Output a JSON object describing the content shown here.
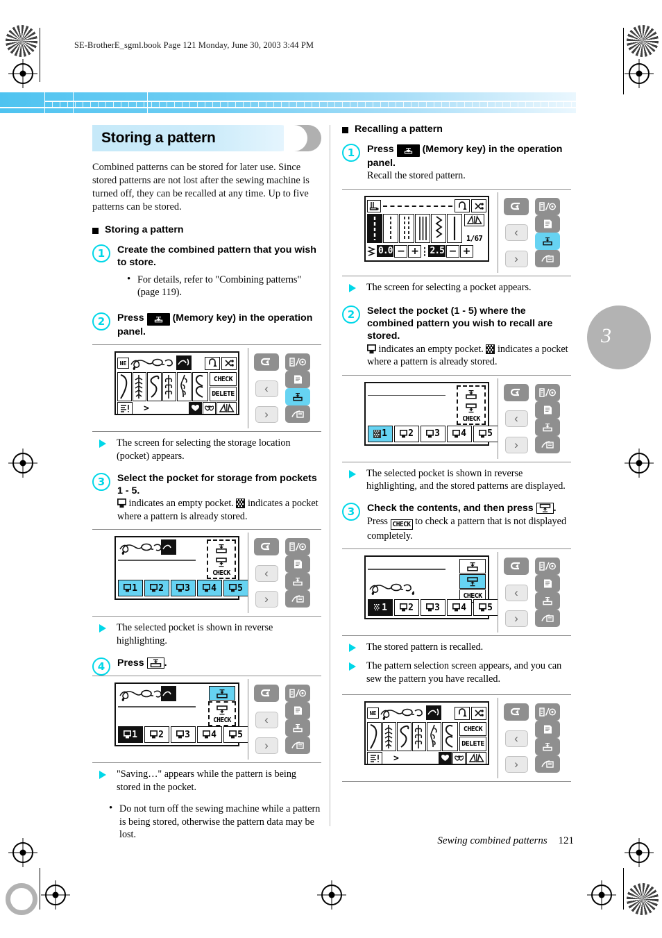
{
  "page": {
    "running_header": "SE-BrotherE_sgml.book  Page 121  Monday, June 30, 2003  3:44 PM",
    "chapter_tab": "3",
    "footer_title": "Sewing combined patterns",
    "footer_page": "121",
    "accent_cyan": "#00d7e8",
    "lcd_select_cyan": "#66d3f2",
    "band_blue": "#4ec3f0"
  },
  "left_column": {
    "section_title": "Storing a pattern",
    "intro": "Combined patterns can be stored for later use. Since stored patterns are not lost after the sewing machine is turned off, they can be recalled at any time. Up to five patterns can be stored.",
    "subhead": "Storing a pattern",
    "step1": {
      "num": "1",
      "head": "Create the combined pattern that you wish to store.",
      "bullet": "For details, refer to \"Combining patterns\" (page 119)."
    },
    "step2": {
      "num": "2",
      "head_pre": "Press",
      "head_post": "(Memory key) in the operation panel.",
      "result": "The screen for selecting the storage location (pocket) appears."
    },
    "step3": {
      "num": "3",
      "head": "Select the pocket for storage from pockets 1 - 5.",
      "sub_a": "indicates an empty pocket.",
      "sub_b": "indicates a pocket where a pattern is already stored.",
      "result": "The selected pocket is shown in reverse highlighting."
    },
    "step4": {
      "num": "4",
      "head_pre": "Press",
      "head_post": ".",
      "result": "\"Saving…\" appears while the pattern is being stored in the pocket.",
      "bullet": "Do not turn off the sewing machine while a pattern is being stored, otherwise the pattern data may be lost."
    }
  },
  "right_column": {
    "subhead": "Recalling a pattern",
    "step1": {
      "num": "1",
      "head_pre": "Press",
      "head_post": "(Memory key) in the operation panel.",
      "sub": "Recall the stored pattern.",
      "result": "The screen for selecting a pocket appears."
    },
    "step2": {
      "num": "2",
      "head": "Select the pocket (1 - 5) where the combined pattern you wish to recall are stored.",
      "sub_a": "indicates an empty pocket.",
      "sub_b": "indicates a pocket where a pattern is already stored.",
      "result": "The selected pocket is shown in reverse highlighting, and the stored patterns are displayed."
    },
    "step3": {
      "num": "3",
      "head_pre": "Check the contents, and then press",
      "head_post": ".",
      "sub_pre": "Press",
      "sub_post": "to check a pattern that is not displayed completely.",
      "result_a": "The stored pattern is recalled.",
      "result_b": "The pattern selection screen appears, and you can sew the pattern you have recalled."
    }
  },
  "lcd": {
    "pockets": [
      "1",
      "2",
      "3",
      "4",
      "5"
    ],
    "check_label": "CHECK",
    "delete_label": "DELETE",
    "page_indicator": "1/67",
    "value_left": "0.0",
    "value_right": "2.5",
    "minus": "−",
    "plus": "+",
    "prev_arrow": "‹",
    "next_arrow": "›",
    "back_arrow": "back-arrow",
    "more_arrow": ">",
    "screens": {
      "combined_pattern": {
        "name": "combined-pattern-screen",
        "check": "CHECK",
        "delete": "DELETE"
      },
      "pocket_store": {
        "name": "pocket-storage-screen",
        "selected": "none"
      },
      "pocket_store_selected": {
        "name": "pocket-storage-screen-selected",
        "selected": "1"
      },
      "stitch_select": {
        "name": "stitch-selection-screen",
        "page": "1/67"
      },
      "pocket_recall": {
        "name": "pocket-recall-screen",
        "selected": "1"
      },
      "pocket_recall_contents": {
        "name": "pocket-recall-contents-screen",
        "selected": "1"
      }
    }
  }
}
